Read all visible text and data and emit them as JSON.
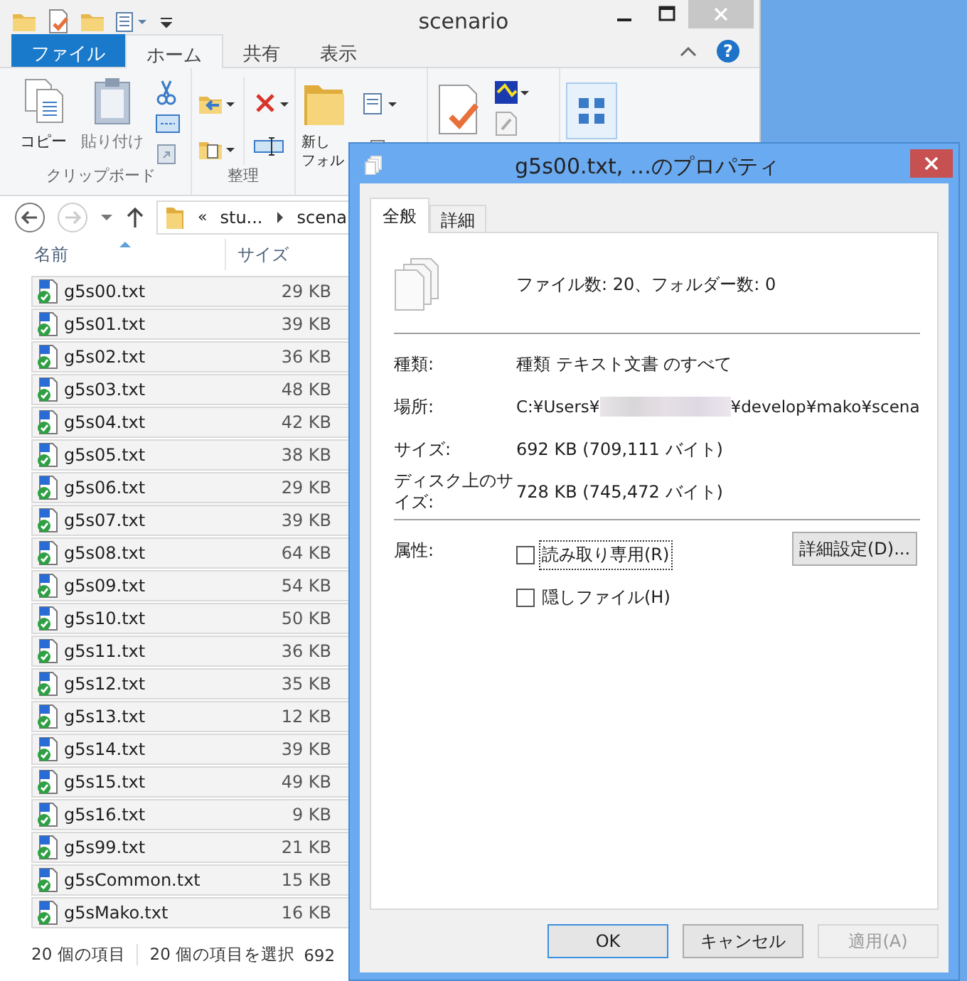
{
  "explorer": {
    "title": "scenario",
    "ribbon_tabs": [
      {
        "label": "ファイル",
        "kind": "file",
        "selected": false
      },
      {
        "label": "ホーム",
        "kind": "tab",
        "selected": true
      },
      {
        "label": "共有",
        "kind": "tab",
        "selected": false
      },
      {
        "label": "表示",
        "kind": "tab",
        "selected": false
      }
    ],
    "help": "?",
    "ribbon_groups": [
      {
        "kind": "clipboard",
        "label": "クリップボード",
        "buttons": [
          "コピー",
          "貼り付け"
        ]
      },
      {
        "kind": "organize",
        "label": "整理"
      },
      {
        "kind": "new",
        "buttons": [
          "新し",
          "フォル"
        ]
      },
      {
        "kind": "open"
      },
      {
        "kind": "select"
      }
    ],
    "address": {
      "overflow": "«",
      "parts": [
        "stu...",
        "scena"
      ]
    },
    "columns": [
      "名前",
      "サイズ"
    ],
    "files": [
      {
        "name": "g5s00.txt",
        "size": "29 KB",
        "selected": true
      },
      {
        "name": "g5s01.txt",
        "size": "39 KB",
        "selected": true
      },
      {
        "name": "g5s02.txt",
        "size": "36 KB",
        "selected": true
      },
      {
        "name": "g5s03.txt",
        "size": "48 KB",
        "selected": true
      },
      {
        "name": "g5s04.txt",
        "size": "42 KB",
        "selected": true
      },
      {
        "name": "g5s05.txt",
        "size": "38 KB",
        "selected": true
      },
      {
        "name": "g5s06.txt",
        "size": "29 KB",
        "selected": true
      },
      {
        "name": "g5s07.txt",
        "size": "39 KB",
        "selected": true
      },
      {
        "name": "g5s08.txt",
        "size": "64 KB",
        "selected": true
      },
      {
        "name": "g5s09.txt",
        "size": "54 KB",
        "selected": true
      },
      {
        "name": "g5s10.txt",
        "size": "50 KB",
        "selected": true
      },
      {
        "name": "g5s11.txt",
        "size": "36 KB",
        "selected": true
      },
      {
        "name": "g5s12.txt",
        "size": "35 KB",
        "selected": true
      },
      {
        "name": "g5s13.txt",
        "size": "12 KB",
        "selected": true
      },
      {
        "name": "g5s14.txt",
        "size": "39 KB",
        "selected": true
      },
      {
        "name": "g5s15.txt",
        "size": "49 KB",
        "selected": true
      },
      {
        "name": "g5s16.txt",
        "size": "9 KB",
        "selected": true
      },
      {
        "name": "g5s99.txt",
        "size": "21 KB",
        "selected": true
      },
      {
        "name": "g5sCommon.txt",
        "size": "15 KB",
        "selected": true
      },
      {
        "name": "g5sMako.txt",
        "size": "16 KB",
        "selected": true
      }
    ],
    "status": [
      "20 個の項目",
      "20 個の項目を選択",
      "692"
    ]
  },
  "dialog": {
    "title": "g5s00.txt, …のプロパティ",
    "tabs": [
      {
        "label": "全般",
        "selected": true
      },
      {
        "label": "詳細",
        "selected": false
      }
    ],
    "summary": "ファイル数: 20、フォルダー数: 0",
    "properties": [
      {
        "kind": "text",
        "label": "種類:",
        "value": "種類 テキスト文書 のすべて"
      },
      {
        "kind": "path",
        "label": "場所:",
        "value_before": "C:¥Users¥",
        "value_after": "¥develop¥mako¥scena"
      },
      {
        "kind": "text",
        "label": "サイズ:",
        "value": "692 KB (709,111 バイト)"
      },
      {
        "kind": "text",
        "label": "ディスク上のサイズ:",
        "value": "728 KB (745,472 バイト)"
      }
    ],
    "attributes": {
      "label": "属性:",
      "checkboxes": [
        {
          "label": "読み取り専用(R)",
          "checked": false,
          "focused": true
        },
        {
          "label": "隠しファイル(H)",
          "checked": false,
          "focused": false
        }
      ],
      "advanced_button": "詳細設定(D)..."
    },
    "buttons": [
      {
        "label": "OK",
        "default": true,
        "disabled": false
      },
      {
        "label": "キャンセル",
        "default": false,
        "disabled": false
      },
      {
        "label": "適用(A)",
        "default": false,
        "disabled": true
      }
    ]
  }
}
